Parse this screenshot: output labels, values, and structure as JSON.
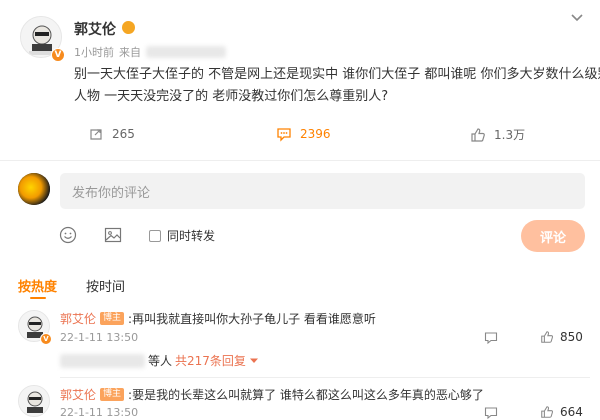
{
  "post": {
    "author": "郭艾伦",
    "time": "1小时前",
    "source_prefix": "来自",
    "text": "别一天大侄子大侄子的 不管是网上还是现实中 谁你们大侄子 都叫谁呢 你们多大岁数什么级别人物 一天天没完没了的 老师没教过你们怎么尊重别人?",
    "repost_count": "265",
    "comment_count": "2396",
    "like_count": "1.3万"
  },
  "composer": {
    "placeholder": "发布你的评论",
    "repost_label": "同时转发",
    "submit_label": "评论"
  },
  "tabs": [
    {
      "label": "按热度",
      "active": true
    },
    {
      "label": "按时间",
      "active": false
    }
  ],
  "comments": [
    {
      "author": "郭艾伦",
      "tag": "博主",
      "text": ":再叫我就直接叫你大孙子龟儿子 看看谁愿意听",
      "time": "22-1-11 13:50",
      "like_count": "850",
      "replies_suffix": "等人",
      "replies_count": "共217条回复"
    },
    {
      "author": "郭艾伦",
      "tag": "博主",
      "text": ":要是我的长辈这么叫就算了 谁特么都这么叫这么多年真的恶心够了",
      "time": "22-1-11 13:50",
      "like_count": "664"
    }
  ],
  "colors": {
    "accent": "#ff8200",
    "username": "#eb7350",
    "submit_disabled": "#ffc09f"
  },
  "icons": {
    "more": "chevron-down-icon",
    "repost": "repost-icon",
    "comment": "comment-icon",
    "like": "thumbs-up-icon",
    "emoji": "emoji-icon",
    "image": "image-icon",
    "checkbox": "checkbox-icon",
    "reply": "reply-icon",
    "dropdown": "caret-down-icon"
  }
}
